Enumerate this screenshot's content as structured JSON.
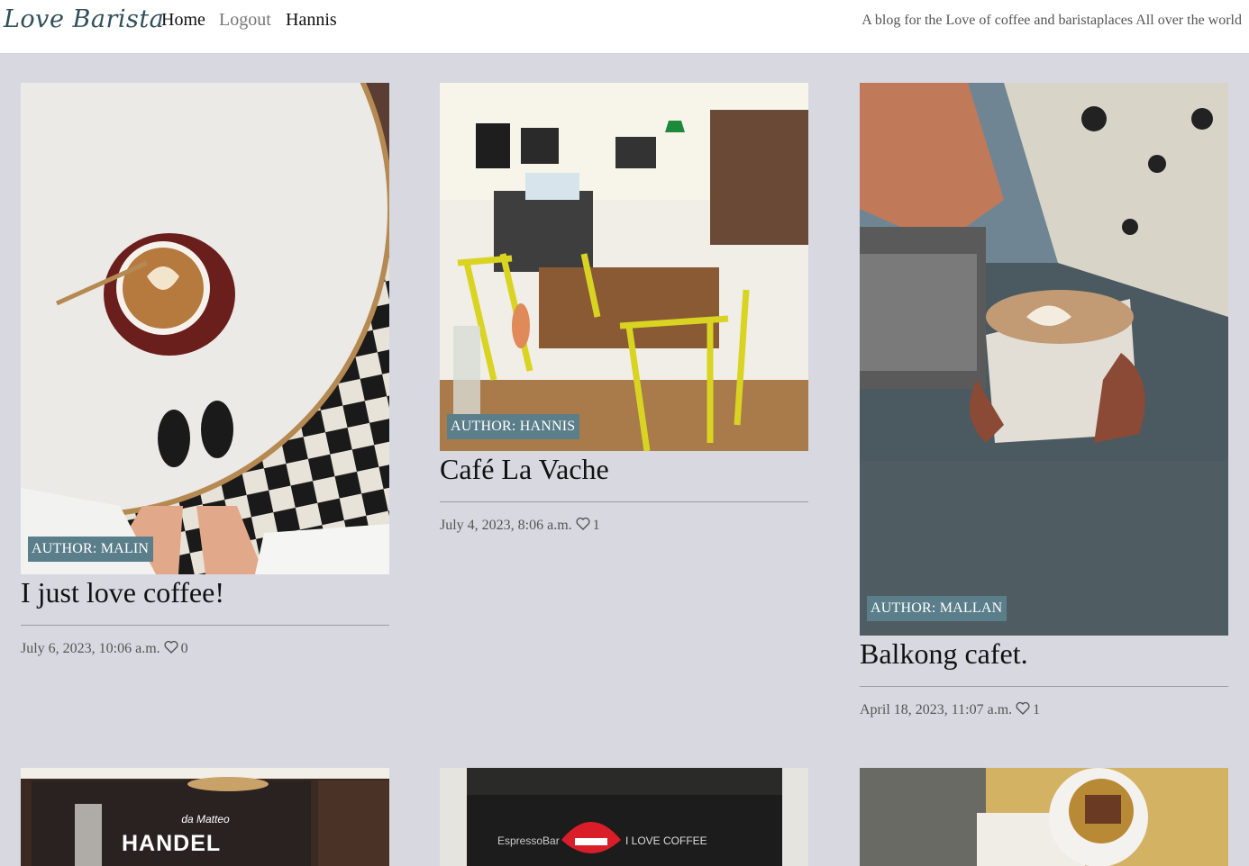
{
  "header": {
    "brand": "Love Barista",
    "nav": [
      "Home",
      "Logout",
      "Hannis"
    ],
    "tagline": "A blog for the Love of coffee and baristaplaces All over the world"
  },
  "posts": [
    {
      "author_label": "AUTHOR: MALIN",
      "title": "I just love coffee!",
      "date": "July 6, 2023, 10:06 a.m.",
      "likes": "0"
    },
    {
      "author_label": "AUTHOR: HANNIS",
      "title": "Café La Vache",
      "date": "July 4, 2023, 8:06 a.m.",
      "likes": "1"
    },
    {
      "author_label": "AUTHOR: MALLAN",
      "title": "Balkong cafet.",
      "date": "April 18, 2023, 11:07 a.m.",
      "likes": "1"
    },
    {
      "sign_text": "HANDEL",
      "sign_small": "da Matteo"
    },
    {
      "sign_left": "EspressoBar",
      "sign_right": "I LOVE COFFEE"
    },
    {}
  ],
  "colors": {
    "background": "#d8d8e1",
    "badge": "#5b7e8b",
    "brand": "#2f4f5c"
  }
}
